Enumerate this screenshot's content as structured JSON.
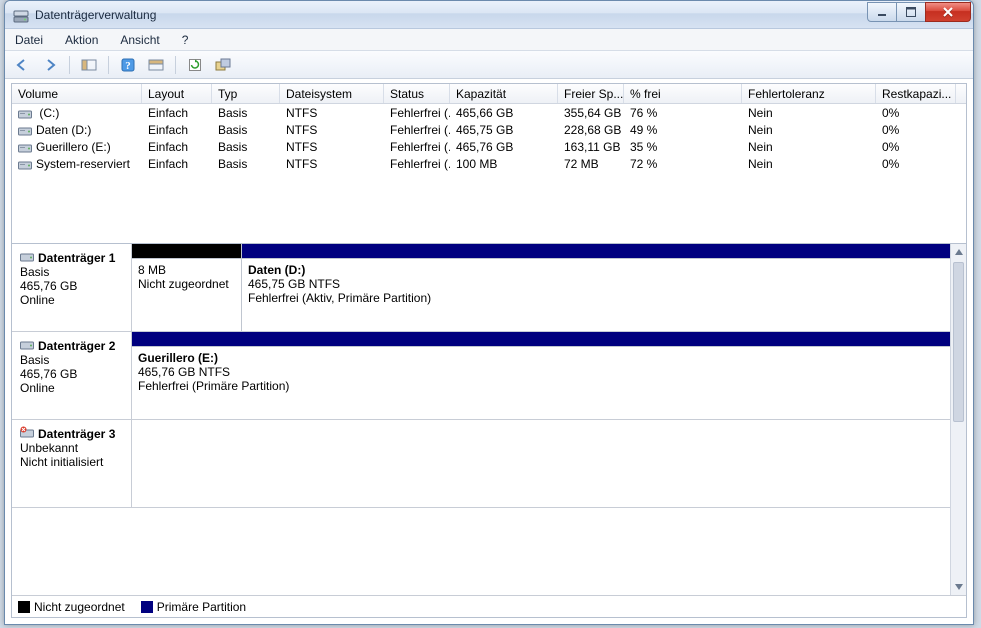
{
  "window": {
    "title": "Datenträgerverwaltung"
  },
  "menu": {
    "file": "Datei",
    "action": "Aktion",
    "view": "Ansicht",
    "help": "?"
  },
  "columns": {
    "volume": "Volume",
    "layout": "Layout",
    "type": "Typ",
    "fs": "Dateisystem",
    "status": "Status",
    "capacity": "Kapazität",
    "free": "Freier Sp...",
    "pctfree": "% frei",
    "fault": "Fehlertoleranz",
    "rest": "Restkapazi..."
  },
  "volumes": [
    {
      "name": " (C:)",
      "layout": "Einfach",
      "type": "Basis",
      "fs": "NTFS",
      "status": "Fehlerfrei (...",
      "capacity": "465,66 GB",
      "free": "355,64 GB",
      "pct": "76 %",
      "fault": "Nein",
      "rest": "0%"
    },
    {
      "name": "Daten (D:)",
      "layout": "Einfach",
      "type": "Basis",
      "fs": "NTFS",
      "status": "Fehlerfrei (...",
      "capacity": "465,75 GB",
      "free": "228,68 GB",
      "pct": "49 %",
      "fault": "Nein",
      "rest": "0%"
    },
    {
      "name": "Guerillero (E:)",
      "layout": "Einfach",
      "type": "Basis",
      "fs": "NTFS",
      "status": "Fehlerfrei (...",
      "capacity": "465,76 GB",
      "free": "163,11 GB",
      "pct": "35 %",
      "fault": "Nein",
      "rest": "0%"
    },
    {
      "name": "System-reserviert",
      "layout": "Einfach",
      "type": "Basis",
      "fs": "NTFS",
      "status": "Fehlerfrei (...",
      "capacity": "100 MB",
      "free": "72 MB",
      "pct": "72 %",
      "fault": "Nein",
      "rest": "0%"
    }
  ],
  "disks": {
    "d1": {
      "name": "Datenträger 1",
      "type": "Basis",
      "size": "465,76 GB",
      "state": "Online",
      "unalloc": {
        "size": "8 MB",
        "status": "Nicht zugeordnet"
      },
      "p1": {
        "name": "Daten  (D:)",
        "info": "465,75 GB NTFS",
        "status": "Fehlerfrei (Aktiv, Primäre Partition)"
      }
    },
    "d2": {
      "name": "Datenträger 2",
      "type": "Basis",
      "size": "465,76 GB",
      "state": "Online",
      "p1": {
        "name": "Guerillero  (E:)",
        "info": "465,76 GB NTFS",
        "status": "Fehlerfrei (Primäre Partition)"
      }
    },
    "d3": {
      "name": "Datenträger 3",
      "type": "Unbekannt",
      "blank": "",
      "state": "Nicht initialisiert"
    }
  },
  "legend": {
    "unalloc": "Nicht zugeordnet",
    "primary": "Primäre Partition"
  },
  "colors": {
    "primary": "#00007f",
    "unalloc": "#000000"
  }
}
